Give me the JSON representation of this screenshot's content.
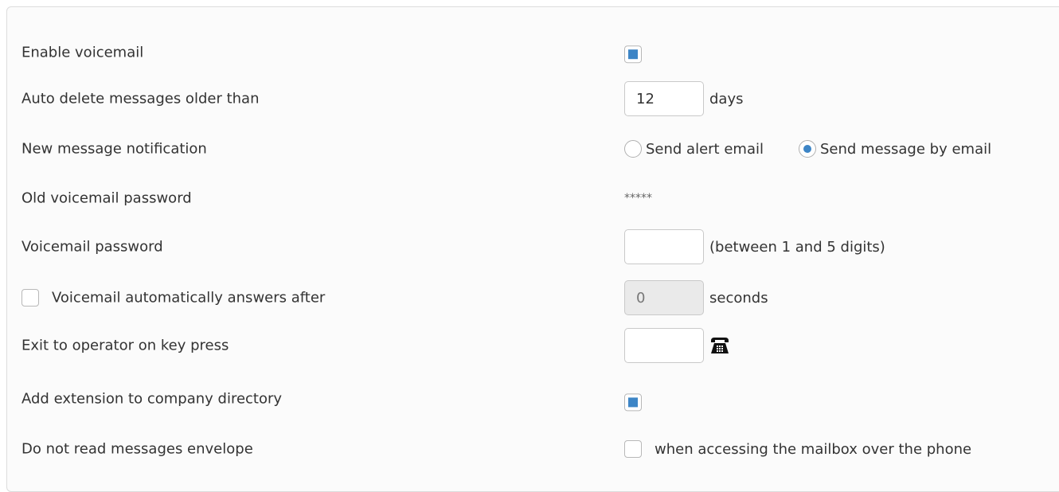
{
  "settings": {
    "enable_voicemail": {
      "label": "Enable voicemail",
      "checked": true
    },
    "auto_delete": {
      "label": "Auto delete messages older than",
      "value": "12",
      "unit": "days"
    },
    "notification": {
      "label": "New message notification",
      "options": [
        {
          "label": "Send alert email",
          "selected": false
        },
        {
          "label": "Send message by email",
          "selected": true
        }
      ]
    },
    "old_password": {
      "label": "Old voicemail password",
      "value": "*****"
    },
    "password": {
      "label": "Voicemail password",
      "value": "",
      "hint": "(between 1 and 5 digits)"
    },
    "auto_answer": {
      "label": "Voicemail automatically answers after",
      "checked": false,
      "value": "0",
      "unit": "seconds",
      "disabled": true
    },
    "exit_operator": {
      "label": "Exit to operator on key press",
      "value": "",
      "icon": "telephone-icon"
    },
    "company_directory": {
      "label": "Add extension to company directory",
      "checked": true
    },
    "no_envelope": {
      "label": "Do not read messages envelope",
      "checked": false,
      "option_label": "when accessing the mailbox over the phone"
    }
  },
  "colors": {
    "accent": "#3d85c6",
    "panel_bg": "#fbfbfb",
    "border": "#dcdcdc",
    "disabled_bg": "#eaeaea"
  }
}
